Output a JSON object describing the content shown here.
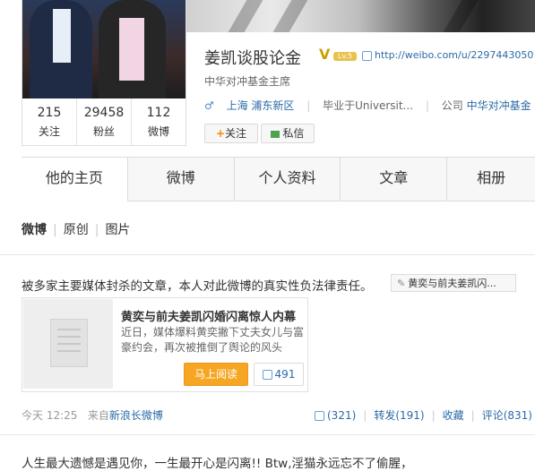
{
  "profile": {
    "name": "姜凯谈股论金",
    "verified_badge": "V",
    "level_badge": "Lv.5",
    "url": "http://weibo.com/u/2297443050",
    "bio": "中华对冲基金主席",
    "gender_icon": "♂",
    "location": "上海 浦东新区",
    "education": "毕业于Universit...",
    "company_label": "公司",
    "company": "中华对冲基金"
  },
  "stats": [
    {
      "value": "215",
      "label": "关注"
    },
    {
      "value": "29458",
      "label": "粉丝"
    },
    {
      "value": "112",
      "label": "微博"
    }
  ],
  "buttons": {
    "follow": "关注",
    "message": "私信"
  },
  "tabs": [
    "他的主页",
    "微博",
    "个人资料",
    "文章",
    "相册"
  ],
  "subnav": [
    "微博",
    "原创",
    "图片"
  ],
  "post": {
    "text": "被多家主要媒体封杀的文章，本人对此微博的真实性负法律责任。",
    "link_label": "黄奕与前夫姜凯闪...",
    "card": {
      "title": "黄奕与前夫姜凯闪婚闪离惊人内幕",
      "desc": "近日，媒体爆料黄奕撇下丈夫女儿与富豪约会，再次被推倒了舆论的风头",
      "read_button": "马上阅读",
      "likes": "491"
    },
    "time": "今天 12:25",
    "source_prefix": "来自",
    "source": "新浪长微博",
    "actions": {
      "like": "(321)",
      "repost": "转发(191)",
      "favorite": "收藏",
      "comment": "评论(831)"
    }
  },
  "post2": {
    "text": "人生最大遗憾是遇见你，一生最开心是闪离!! Btw,淫猫永远忘不了偷腥，"
  },
  "colors": {
    "link": "#2a6aa7",
    "read_button": "#f6a623"
  }
}
